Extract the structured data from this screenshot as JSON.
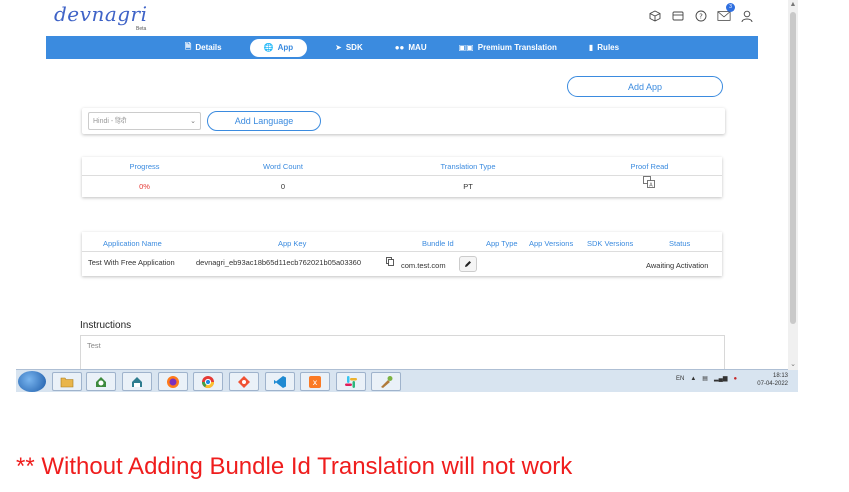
{
  "header": {
    "logo_text": "devnagri",
    "logo_sub": "Beta",
    "notification_count": "3"
  },
  "nav": {
    "items": [
      {
        "label": "Details",
        "icon": "document-icon"
      },
      {
        "label": "App",
        "icon": "globe-icon"
      },
      {
        "label": "SDK",
        "icon": "rocket-icon"
      },
      {
        "label": "MAU",
        "icon": "users-icon"
      },
      {
        "label": "Premium Translation",
        "icon": "table-icon"
      },
      {
        "label": "Rules",
        "icon": "file-icon"
      }
    ],
    "active": "App"
  },
  "add_app_label": "Add App",
  "language": {
    "select_value": "Hindi - हिंदी",
    "add_label": "Add Language"
  },
  "progress_table": {
    "headers": [
      "Progress",
      "Word Count",
      "Translation Type",
      "Proof Read"
    ],
    "row": {
      "progress": "0%",
      "word_count": "0",
      "translation_type": "PT"
    }
  },
  "app_table": {
    "headers": [
      "Application Name",
      "App Key",
      "Bundle Id",
      "App Type",
      "App Versions",
      "SDK Versions",
      "Status"
    ],
    "row": {
      "name": "Test With Free Application",
      "key": "devnagri_eb93ac18b65d11ecb762021b05a03360",
      "bundle_id": "com.test.com",
      "status": "Awaiting Activation"
    }
  },
  "instructions": {
    "label": "Instructions",
    "text": "Test"
  },
  "taskbar": {
    "time": "18:13",
    "date": "07-04-2022",
    "lang": "EN"
  },
  "warning_text": "** Without Adding Bundle Id Translation will not work",
  "colors": {
    "accent": "#3b8bdf",
    "warning": "#ef1d1d",
    "progress": "#e53935"
  }
}
